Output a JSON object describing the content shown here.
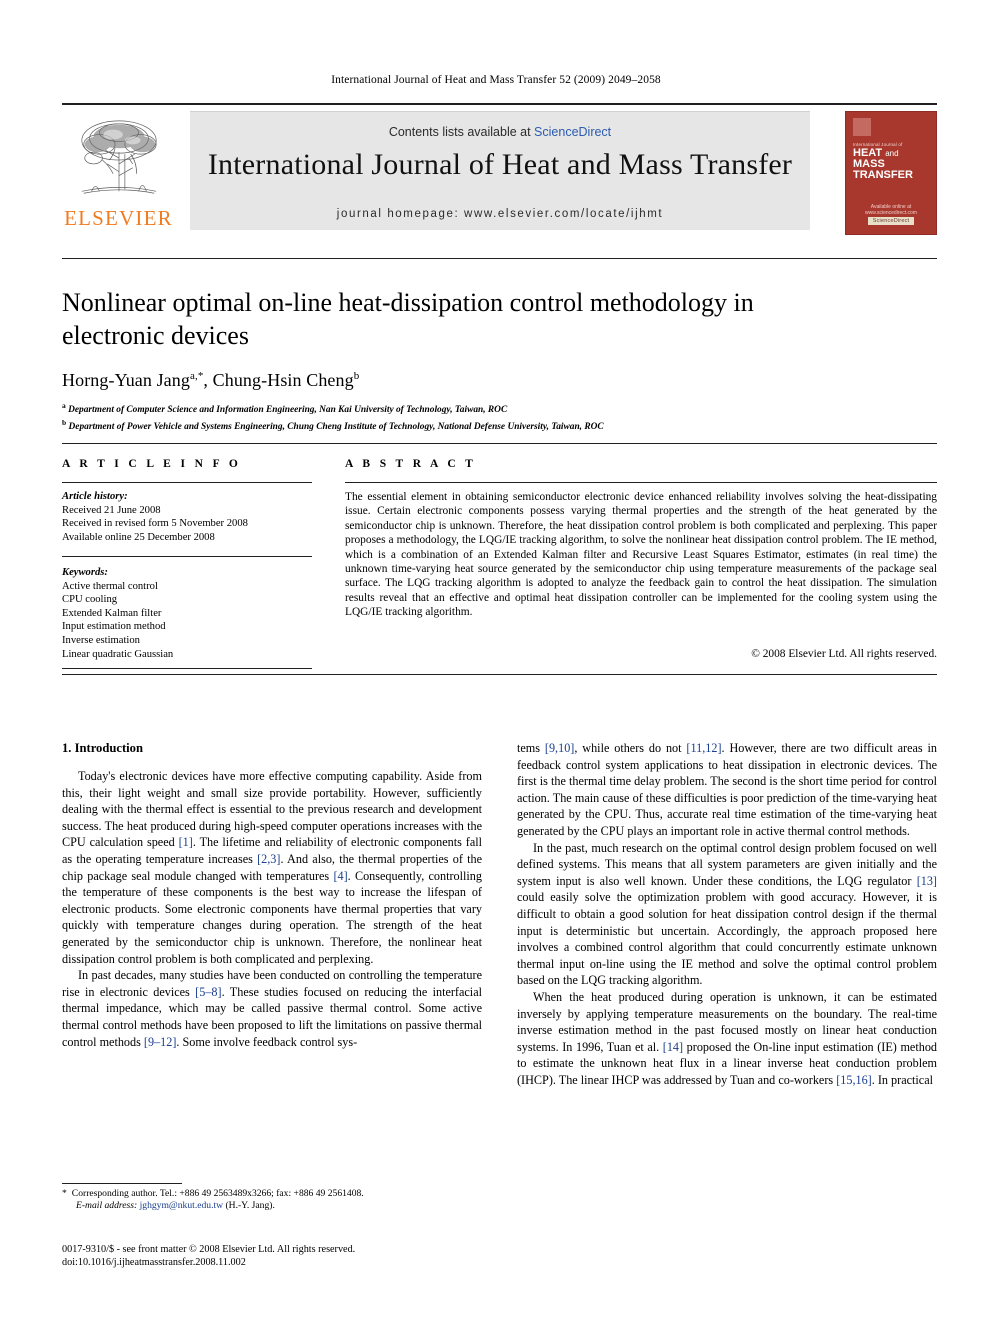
{
  "running_head": "International Journal of Heat and Mass Transfer 52 (2009) 2049–2058",
  "masthead": {
    "contents_prefix": "Contents lists available at ",
    "contents_link": "ScienceDirect",
    "journal_title": "International Journal of Heat and Mass Transfer",
    "homepage": "journal homepage: www.elsevier.com/locate/ijhmt",
    "publisher_name": "ELSEVIER",
    "cover": {
      "superline": "International Journal of",
      "line1": "HEAT",
      "line1b": "and",
      "line1c": "MASS",
      "line2": "TRANSFER",
      "badge": "ScienceDirect",
      "foot": "Available online at www.sciencedirect.com"
    }
  },
  "article": {
    "title": "Nonlinear optimal on-line heat-dissipation control methodology in electronic devices",
    "authors_plain": "Horng-Yuan Jang a,*, Chung-Hsin Cheng b",
    "author1_name": "Horng-Yuan Jang",
    "author1_sup": "a,*",
    "author2_name": "Chung-Hsin Cheng",
    "author2_sup": "b",
    "affiliation_a": "Department of Computer Science and Information Engineering, Nan Kai University of Technology, Taiwan, ROC",
    "affiliation_b": "Department of Power Vehicle and Systems Engineering, Chung Cheng Institute of Technology, National Defense University, Taiwan, ROC"
  },
  "info": {
    "heading": "A R T I C L E    I N F O",
    "history_label": "Article history:",
    "history": [
      "Received 21 June 2008",
      "Received in revised form 5 November 2008",
      "Available online 25 December 2008"
    ],
    "keywords_label": "Keywords:",
    "keywords": [
      "Active thermal control",
      "CPU cooling",
      "Extended Kalman filter",
      "Input estimation method",
      "Inverse estimation",
      "Linear quadratic Gaussian"
    ]
  },
  "abstract": {
    "heading": "A B S T R A C T",
    "text": "The essential element in obtaining semiconductor electronic device enhanced reliability involves solving the heat-dissipating issue. Certain electronic components possess varying thermal properties and the strength of the heat generated by the semiconductor chip is unknown. Therefore, the heat dissipation control problem is both complicated and perplexing. This paper proposes a methodology, the LQG/IE tracking algorithm, to solve the nonlinear heat dissipation control problem. The IE method, which is a combination of an Extended Kalman filter and Recursive Least Squares Estimator, estimates (in real time) the unknown time-varying heat source generated by the semiconductor chip using temperature measurements of the package seal surface. The LQG tracking algorithm is adopted to analyze the feedback gain to control the heat dissipation. The simulation results reveal that an effective and optimal heat dissipation controller can be implemented for the cooling system using the LQG/IE tracking algorithm.",
    "copyright": "© 2008 Elsevier Ltd. All rights reserved."
  },
  "body": {
    "section_heading": "1. Introduction",
    "left_paragraphs": [
      "Today's electronic devices have more effective computing capability. Aside from this, their light weight and small size provide portability. However, sufficiently dealing with the thermal effect is essential to the previous research and development success. The heat produced during high-speed computer operations increases with the CPU calculation speed [1]. The lifetime and reliability of electronic components fall as the operating temperature increases [2,3]. And also, the thermal properties of the chip package seal module changed with temperatures [4]. Consequently, controlling the temperature of these components is the best way to increase the lifespan of electronic products. Some electronic components have thermal properties that vary quickly with temperature changes during operation. The strength of the heat generated by the semiconductor chip is unknown. Therefore, the nonlinear heat dissipation control problem is both complicated and perplexing.",
      "In past decades, many studies have been conducted on controlling the temperature rise in electronic devices [5–8]. These studies focused on reducing the interfacial thermal impedance, which may be called passive thermal control. Some active thermal control methods have been proposed to lift the limitations on passive thermal control methods [9–12]. Some involve feedback control sys-"
    ],
    "right_paragraphs": [
      "tems [9,10], while others do not [11,12]. However, there are two difficult areas in feedback control system applications to heat dissipation in electronic devices. The first is the thermal time delay problem. The second is the short time period for control action. The main cause of these difficulties is poor prediction of the time-varying heat generated by the CPU. Thus, accurate real time estimation of the time-varying heat generated by the CPU plays an important role in active thermal control methods.",
      "In the past, much research on the optimal control design problem focused on well defined systems. This means that all system parameters are given initially and the system input is also well known. Under these conditions, the LQG regulator [13] could easily solve the optimization problem with good accuracy. However, it is difficult to obtain a good solution for heat dissipation control design if the thermal input is deterministic but uncertain. Accordingly, the approach proposed here involves a combined control algorithm that could concurrently estimate unknown thermal input on-line using the IE method and solve the optimal control problem based on the LQG tracking algorithm.",
      "When the heat produced during operation is unknown, it can be estimated inversely by applying temperature measurements on the boundary. The real-time inverse estimation method in the past focused mostly on linear heat conduction systems. In 1996, Tuan et al. [14] proposed the On-line input estimation (IE) method to estimate the unknown heat flux in a linear inverse heat conduction problem (IHCP). The linear IHCP was addressed by Tuan and co-workers [15,16]. In practical"
    ]
  },
  "footnote": {
    "star": "*",
    "corresponding": "Corresponding author. Tel.: +886 49 2563489x3266; fax: +886 49 2561408.",
    "email_label": "E-mail address:",
    "email": "jghgym@nkut.edu.tw",
    "email_suffix": "(H.-Y. Jang)."
  },
  "imprint": {
    "line1": "0017-9310/$ - see front matter © 2008 Elsevier Ltd. All rights reserved.",
    "line2": "doi:10.1016/j.ijheatmasstransfer.2008.11.002"
  },
  "colors": {
    "link": "#1a3e8c",
    "sciencedirect": "#2b5bb0",
    "elsevier_orange": "#f07c22",
    "cover_red": "#a8382e",
    "band_gray": "#e6e6e6"
  }
}
